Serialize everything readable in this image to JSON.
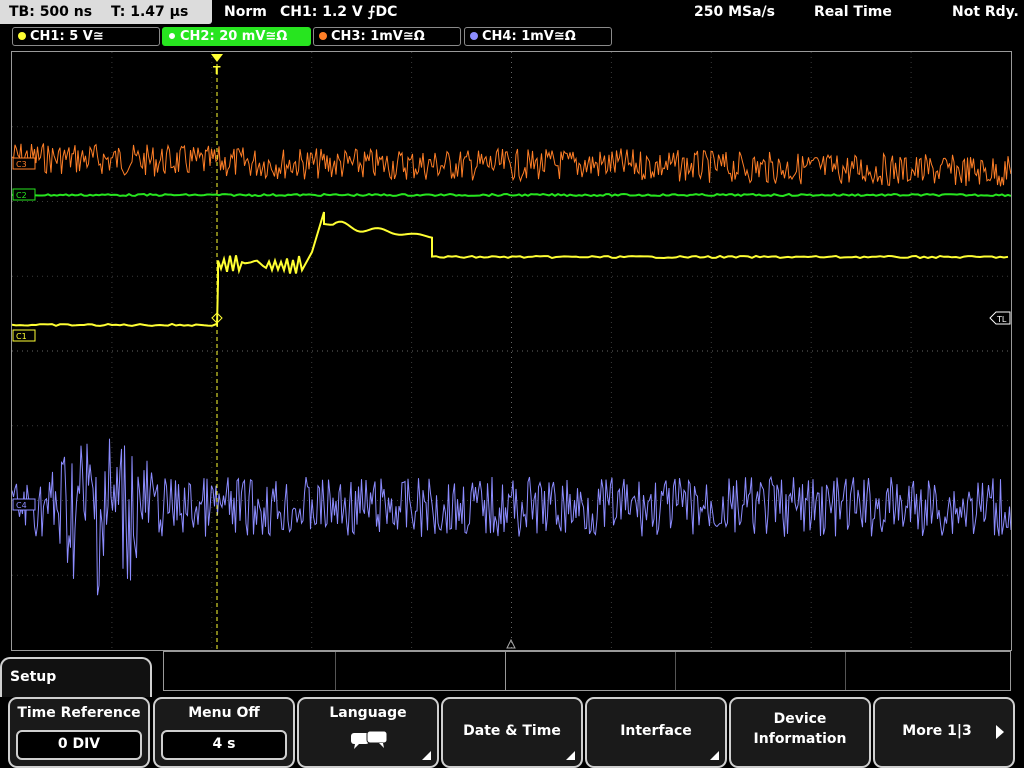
{
  "header": {
    "timebase": "TB: 500 ns",
    "trigger_time": "T: 1.47 µs",
    "mode": "Norm",
    "trigger_info": "CH1: 1.2 V ⨍DC",
    "sample_rate": "250 MSa/s",
    "acquisition": "Real Time",
    "state": "Not Rdy."
  },
  "channels": [
    {
      "label": "CH1: 5 V≅",
      "color": "#ffff33",
      "active": false
    },
    {
      "label": "CH2: 20 mV≅Ω",
      "color": "#27e51f",
      "active": true
    },
    {
      "label": "CH3: 1mV≅Ω",
      "color": "#ff7f27",
      "active": false
    },
    {
      "label": "CH4: 1mV≅Ω",
      "color": "#8c8cff",
      "active": false
    }
  ],
  "markers": {
    "trigger": "T",
    "trigger_level": "TL",
    "ch1": "C1",
    "ch2": "C2",
    "ch3": "C3",
    "ch4": "C4"
  },
  "menu": {
    "title": "Setup",
    "softkeys": [
      {
        "label": "Time Reference",
        "value": "0 DIV"
      },
      {
        "label": "Menu Off",
        "value": "4 s"
      },
      {
        "label": "Language",
        "icon": "speech-bubble-icon"
      },
      {
        "label": "Date & Time"
      },
      {
        "label": "Interface"
      },
      {
        "label_line1": "Device",
        "label_line2": "Information"
      },
      {
        "label": "More 1|3"
      }
    ]
  },
  "colors": {
    "ch1": "#ffff33",
    "ch2": "#27e51f",
    "ch3": "#ff7f27",
    "ch4": "#8c8cff"
  }
}
